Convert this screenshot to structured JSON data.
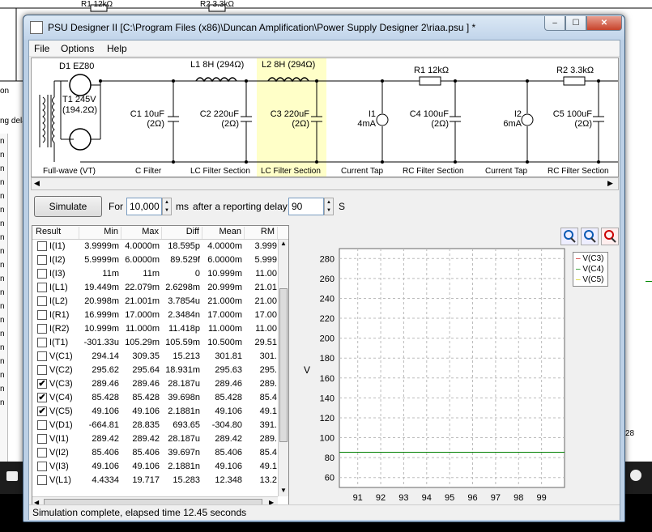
{
  "background": {
    "left_list": [
      "n",
      "n",
      "n",
      "n",
      "n",
      "n",
      "n",
      "n",
      "n",
      "n",
      "n",
      "n",
      "n",
      "n",
      "n",
      "n",
      "n",
      "n",
      "n",
      "n"
    ],
    "partial_labels": [
      "R1 12kΩ",
      "R2 3.3kΩ",
      "on",
      "ng dela"
    ],
    "right_axis_labels": [
      "28",
      "28"
    ]
  },
  "window": {
    "title": "PSU Designer II  [C:\\Program Files (x86)\\Duncan Amplification\\Power Supply Designer 2\\riaa.psu ] *",
    "min_label": "–",
    "max_label": "☐",
    "close_label": "✕"
  },
  "menu": [
    "File",
    "Options",
    "Help"
  ],
  "schematic": {
    "top_labels": {
      "d1": "D1 EZ80",
      "l1": "L1 8H (294Ω)",
      "l2": "L2 8H (294Ω)",
      "r1": "R1 12kΩ",
      "r2": "R2 3.3kΩ",
      "t1": "T1 245V",
      "t1b": "(194.2Ω)"
    },
    "components": [
      {
        "name": "C1 10uF",
        "sub": "(2Ω)"
      },
      {
        "name": "C2 220uF",
        "sub": "(2Ω)"
      },
      {
        "name": "C3 220uF",
        "sub": "(2Ω)"
      },
      {
        "name": "I1",
        "sub": "4mA"
      },
      {
        "name": "C4 100uF",
        "sub": "(2Ω)"
      },
      {
        "name": "I2",
        "sub": "6mA"
      },
      {
        "name": "C5 100uF",
        "sub": "(2Ω)"
      }
    ],
    "sections": [
      "Full-wave (VT)",
      "C Filter",
      "LC Filter Section",
      "LC Filter Section",
      "Current Tap",
      "RC Filter Section",
      "Current Tap",
      "RC Filter Section"
    ]
  },
  "simulation": {
    "button": "Simulate",
    "for_label": "For",
    "duration": "10,000",
    "ms_label": "ms",
    "after_label": "after a reporting delay of",
    "delay": "90",
    "s_label": "S"
  },
  "results": {
    "columns": [
      "Result",
      "Min",
      "Max",
      "Diff",
      "Mean",
      "RM"
    ],
    "rows": [
      {
        "checked": false,
        "name": "I(I1)",
        "min": "3.9999m",
        "max": "4.0000m",
        "diff": "18.595p",
        "mean": "4.0000m",
        "rms": "3.999"
      },
      {
        "checked": false,
        "name": "I(I2)",
        "min": "5.9999m",
        "max": "6.0000m",
        "diff": "89.529f",
        "mean": "6.0000m",
        "rms": "5.999"
      },
      {
        "checked": false,
        "name": "I(I3)",
        "min": "11m",
        "max": "11m",
        "diff": "0",
        "mean": "10.999m",
        "rms": "11.00"
      },
      {
        "checked": false,
        "name": "I(L1)",
        "min": "19.449m",
        "max": "22.079m",
        "diff": "2.6298m",
        "mean": "20.999m",
        "rms": "21.01"
      },
      {
        "checked": false,
        "name": "I(L2)",
        "min": "20.998m",
        "max": "21.001m",
        "diff": "3.7854u",
        "mean": "21.000m",
        "rms": "21.00"
      },
      {
        "checked": false,
        "name": "I(R1)",
        "min": "16.999m",
        "max": "17.000m",
        "diff": "2.3484n",
        "mean": "17.000m",
        "rms": "17.00"
      },
      {
        "checked": false,
        "name": "I(R2)",
        "min": "10.999m",
        "max": "11.000m",
        "diff": "11.418p",
        "mean": "11.000m",
        "rms": "11.00"
      },
      {
        "checked": false,
        "name": "I(T1)",
        "min": "-301.33u",
        "max": "105.29m",
        "diff": "105.59m",
        "mean": "10.500m",
        "rms": "29.51"
      },
      {
        "checked": false,
        "name": "V(C1)",
        "min": "294.14",
        "max": "309.35",
        "diff": "15.213",
        "mean": "301.81",
        "rms": "301."
      },
      {
        "checked": false,
        "name": "V(C2)",
        "min": "295.62",
        "max": "295.64",
        "diff": "18.931m",
        "mean": "295.63",
        "rms": "295."
      },
      {
        "checked": true,
        "name": "V(C3)",
        "min": "289.46",
        "max": "289.46",
        "diff": "28.187u",
        "mean": "289.46",
        "rms": "289."
      },
      {
        "checked": true,
        "name": "V(C4)",
        "min": "85.428",
        "max": "85.428",
        "diff": "39.698n",
        "mean": "85.428",
        "rms": "85.4"
      },
      {
        "checked": true,
        "name": "V(C5)",
        "min": "49.106",
        "max": "49.106",
        "diff": "2.1881n",
        "mean": "49.106",
        "rms": "49.1"
      },
      {
        "checked": false,
        "name": "V(D1)",
        "min": "-664.81",
        "max": "28.835",
        "diff": "693.65",
        "mean": "-304.80",
        "rms": "391."
      },
      {
        "checked": false,
        "name": "V(I1)",
        "min": "289.42",
        "max": "289.42",
        "diff": "28.187u",
        "mean": "289.42",
        "rms": "289."
      },
      {
        "checked": false,
        "name": "V(I2)",
        "min": "85.406",
        "max": "85.406",
        "diff": "39.697n",
        "mean": "85.406",
        "rms": "85.4"
      },
      {
        "checked": false,
        "name": "V(I3)",
        "min": "49.106",
        "max": "49.106",
        "diff": "2.1881n",
        "mean": "49.106",
        "rms": "49.1"
      },
      {
        "checked": false,
        "name": "V(L1)",
        "min": "4.4334",
        "max": "19.717",
        "diff": "15.283",
        "mean": "12.348",
        "rms": "13.2"
      }
    ]
  },
  "plot": {
    "ylabel": "V",
    "yticks": [
      280,
      260,
      240,
      220,
      200,
      180,
      160,
      140,
      120,
      100,
      80,
      60
    ],
    "xticks": [
      91,
      92,
      93,
      94,
      95,
      96,
      97,
      98,
      99
    ],
    "legend": [
      {
        "name": "V(C3)",
        "color": "#cc0000"
      },
      {
        "name": "V(C4)",
        "color": "#008000"
      },
      {
        "name": "V(C5)",
        "color": "#c8c800"
      }
    ],
    "trace_c4": 85.428,
    "zoom_icons": [
      "zoom-in-icon",
      "zoom-out-icon",
      "zoom-reset-icon"
    ]
  },
  "status": "Simulation complete, elapsed time 12.45 seconds"
}
